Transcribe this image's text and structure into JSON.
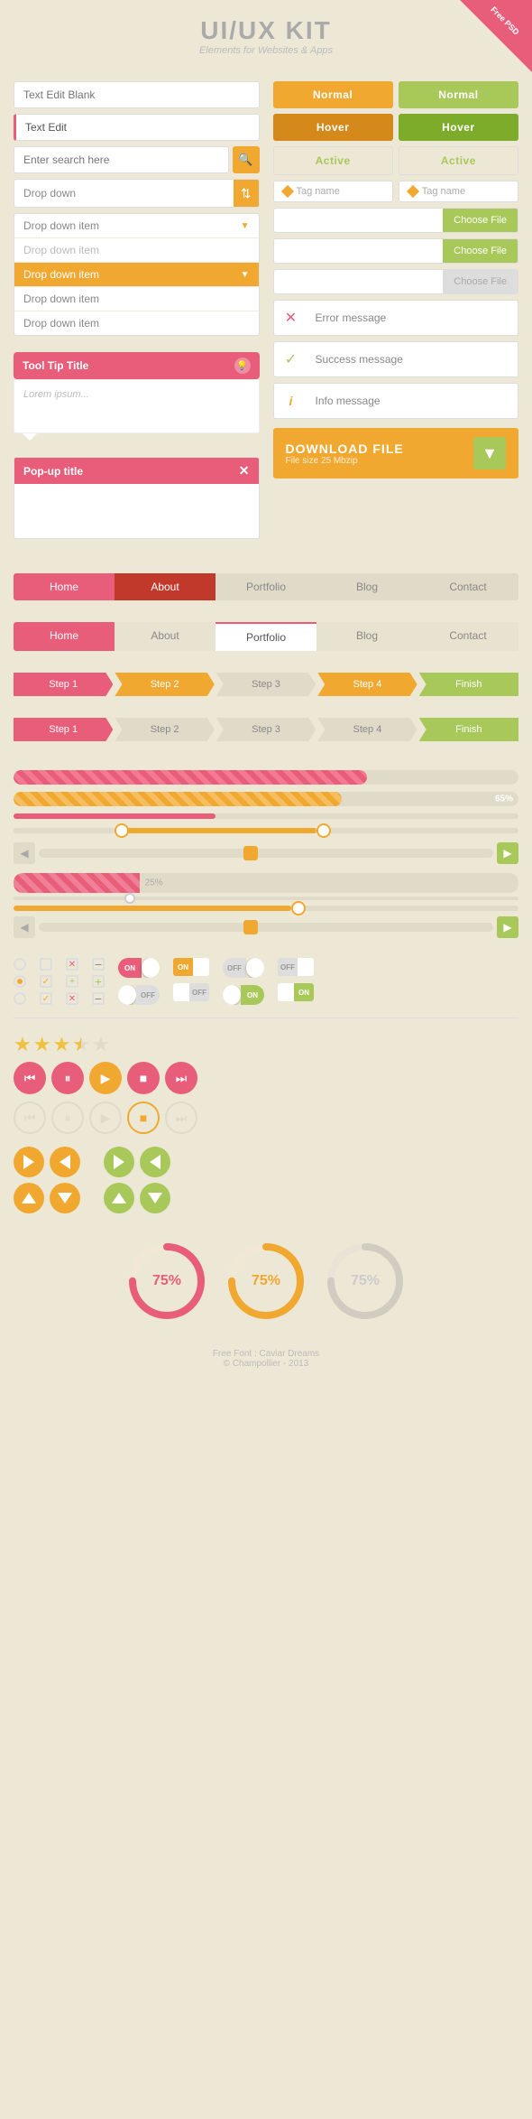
{
  "header": {
    "title": "UI/UX KIT",
    "subtitle": "Elements for Websites & Apps",
    "badge": "Free PSD"
  },
  "left_col": {
    "text_edit_blank_label": "Text Edit Blank",
    "text_edit_label": "Text Edit",
    "search_placeholder": "Enter search here",
    "dropdown_label": "Drop down",
    "dropdown_items": [
      "Drop down item",
      "Drop down item",
      "Drop down item",
      "Drop down item",
      "Drop down item"
    ],
    "tooltip_title": "Tool Tip Title",
    "tooltip_body": "Lorem ipsum...",
    "popup_title": "Pop-up title"
  },
  "right_col": {
    "btn_normal": "Normal",
    "btn_hover": "Hover",
    "btn_active_orange": "Active",
    "btn_active_green": "Active",
    "tag_name": "Tag name",
    "choose_file": "Choose File",
    "choose_file2": "Choose File",
    "choose_file3": "Choose File",
    "error_msg": "Error message",
    "success_msg": "Success message",
    "info_msg": "Info message",
    "download_title": "DOWNLOAD FILE",
    "download_sub": "File size 25 Mbzip",
    "download_arrow": "▼"
  },
  "nav": {
    "items1": [
      "Home",
      "About",
      "Portfolio",
      "Blog",
      "Contact"
    ],
    "items2": [
      "Home",
      "About",
      "Portfolio",
      "Blog",
      "Contact"
    ],
    "active1": 1,
    "active2": 2
  },
  "steps": {
    "items": [
      "Step 1",
      "Step 2",
      "Step 3",
      "Step 4",
      "Finish"
    ],
    "active": 3
  },
  "progress": {
    "value1": "65%",
    "value2": "25%"
  },
  "media": {
    "rewind": "⏮",
    "pause": "⏸",
    "play": "▶",
    "stop": "■",
    "forward": "⏭"
  },
  "stars": {
    "count": 3.5,
    "total": 5
  },
  "circles": {
    "pink_value": 75,
    "pink_label": "75%",
    "orange_value": 75,
    "orange_label": "75%"
  },
  "footer": {
    "line1": "Free Font : Caviar Dreams",
    "line2": "© Champollier - 2013"
  },
  "toggles": {
    "on_label": "ON",
    "off_label": "OFF"
  }
}
